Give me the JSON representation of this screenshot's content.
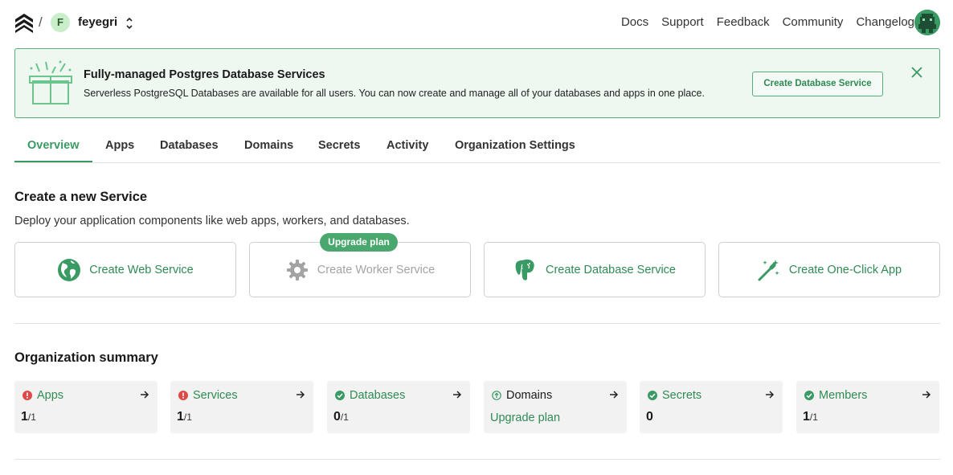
{
  "header": {
    "separator": "/",
    "org_initial": "F",
    "org_name": "feyegri",
    "nav": [
      "Docs",
      "Support",
      "Feedback",
      "Community",
      "Changelog"
    ]
  },
  "banner": {
    "title": "Fully-managed Postgres Database Services",
    "text": "Serverless PostgreSQL Databases are available for all users. You can now create and manage all of your databases and apps in one place.",
    "button": "Create Database Service"
  },
  "tabs": [
    "Overview",
    "Apps",
    "Databases",
    "Domains",
    "Secrets",
    "Activity",
    "Organization Settings"
  ],
  "active_tab": "Overview",
  "create": {
    "title": "Create a new Service",
    "subtitle": "Deploy your application components like web apps, workers, and databases.",
    "upgrade_badge": "Upgrade plan",
    "cards": [
      {
        "label": "Create Web Service",
        "icon": "globe-icon",
        "disabled": false
      },
      {
        "label": "Create Worker Service",
        "icon": "gear-icon",
        "disabled": true
      },
      {
        "label": "Create Database Service",
        "icon": "postgres-elephant-icon",
        "disabled": false
      },
      {
        "label": "Create One-Click App",
        "icon": "magic-wand-icon",
        "disabled": false
      }
    ]
  },
  "summary": {
    "title": "Organization summary",
    "cards": [
      {
        "label": "Apps",
        "status": "error",
        "value": "1",
        "limit": "/1"
      },
      {
        "label": "Services",
        "status": "error",
        "value": "1",
        "limit": "/1"
      },
      {
        "label": "Databases",
        "status": "ok",
        "value": "0",
        "limit": "/1"
      },
      {
        "label": "Domains",
        "status": "upgrade",
        "link": "Upgrade plan"
      },
      {
        "label": "Secrets",
        "status": "ok",
        "value": "0",
        "limit": ""
      },
      {
        "label": "Members",
        "status": "ok",
        "value": "1",
        "limit": "/1"
      }
    ]
  },
  "colors": {
    "accent": "#3a9a64",
    "error": "#e04848",
    "banner_bg": "#eef7f0"
  }
}
